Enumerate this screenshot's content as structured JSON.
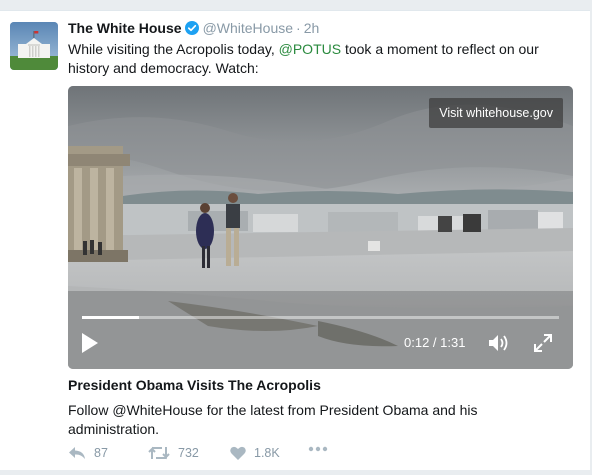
{
  "tweet": {
    "name": "The White House",
    "handle": "@WhiteHouse",
    "time": "2h",
    "text_before": "While visiting the Acropolis today, ",
    "mention": "@POTUS",
    "text_after": " took a moment to reflect on our history and democracy. Watch:"
  },
  "media": {
    "visit_label": "Visit whitehouse.gov",
    "time_label": "0:12 / 1:31",
    "progress": 0.12
  },
  "card": {
    "title": "President Obama Visits The Acropolis",
    "description": "Follow @WhiteHouse for the latest from President Obama and his administration."
  },
  "actions": {
    "reply_count": "87",
    "retweet_count": "732",
    "like_count": "1.8K"
  },
  "icons": {
    "reply": "reply-icon",
    "retweet": "retweet-icon",
    "like": "heart-icon",
    "more": "more-icon",
    "verified": "verified-badge-icon",
    "play": "play-icon",
    "volume": "volume-icon",
    "fullscreen": "fullscreen-icon"
  },
  "colors": {
    "link": "#1b95e0",
    "mention": "#2a8a3e",
    "meta": "#8899a6"
  }
}
